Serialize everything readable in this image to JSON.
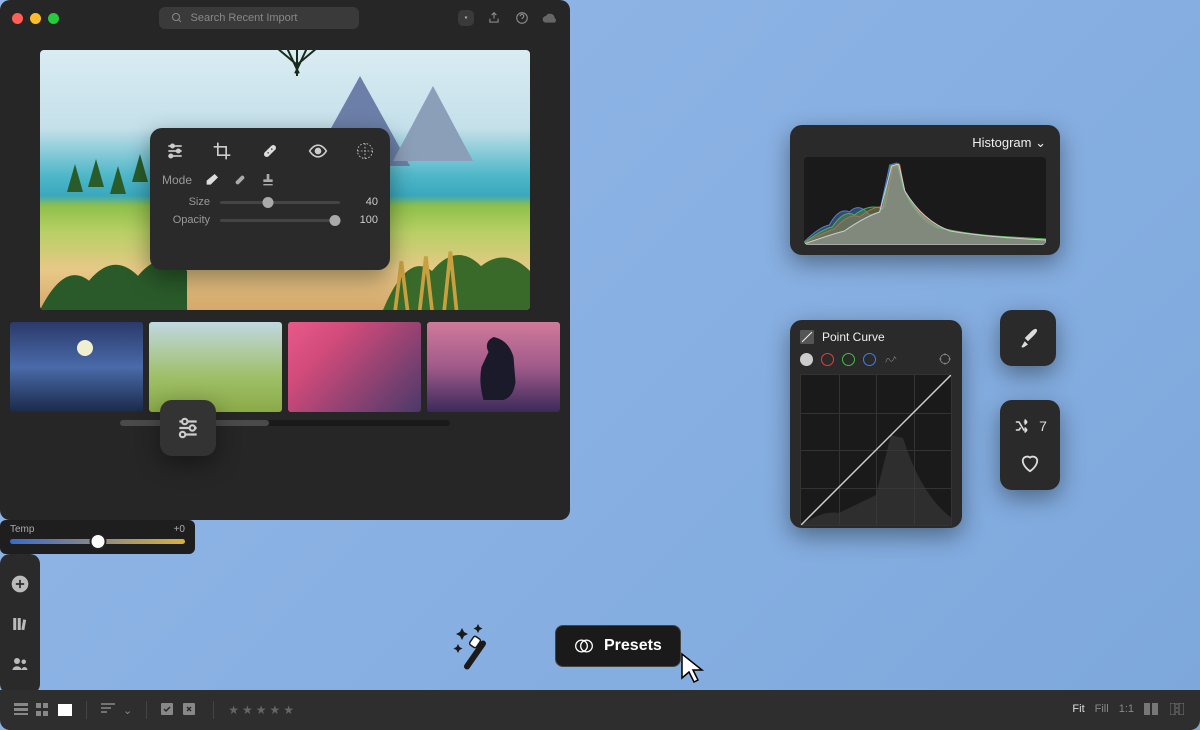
{
  "search": {
    "placeholder": "Search Recent Import"
  },
  "tools": {
    "mode_label": "Mode",
    "size": {
      "label": "Size",
      "value": 40,
      "pct": 40
    },
    "opacity": {
      "label": "Opacity",
      "value": 100,
      "pct": 96
    }
  },
  "temp": {
    "label": "Temp",
    "value": "+0"
  },
  "histogram": {
    "title": "Histogram"
  },
  "point_curve": {
    "title": "Point Curve"
  },
  "sync": {
    "count": 7
  },
  "presets": {
    "label": "Presets"
  },
  "zoom": {
    "fit": "Fit",
    "fill": "Fill",
    "one": "1:1"
  },
  "icons": {
    "sliders": "sliders",
    "crop": "crop",
    "heal": "heal",
    "eye": "eye",
    "mesh": "mesh",
    "eraser": "eraser",
    "bandaid": "bandaid",
    "stamp": "stamp",
    "add": "add",
    "library": "library",
    "people": "people",
    "brush": "brush",
    "shuffle": "shuffle",
    "heart": "heart",
    "funnel": "funnel",
    "share": "share",
    "help": "help",
    "cloud": "cloud",
    "scribble": "scribble"
  }
}
